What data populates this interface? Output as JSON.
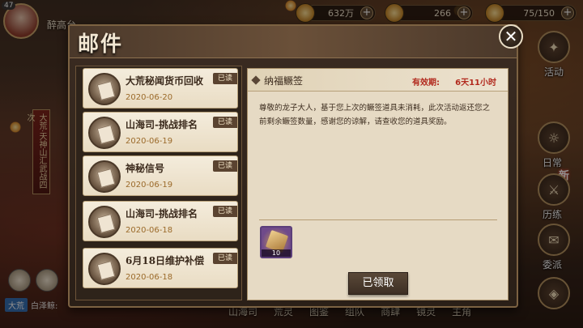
{
  "player": {
    "level": "47",
    "name": "醉高台"
  },
  "resources": [
    {
      "icon": "coin-icon",
      "value": "632万"
    },
    {
      "icon": "gold-ingot-icon",
      "value": "266"
    },
    {
      "icon": "stamina-icon",
      "value": "75/150"
    }
  ],
  "side_menu": {
    "activity": "活动",
    "daily": "日常",
    "trial": "历练",
    "dispatch": "委派",
    "new_tag": "新"
  },
  "left_banner": "大荒·天神山汇武战四次",
  "chat": {
    "channel": "大荒",
    "speaker": "白泽鲸:"
  },
  "bottom_nav": [
    "山海司",
    "荒灵",
    "图鉴",
    "组队",
    "商肆",
    "镜灵",
    "主角"
  ],
  "mail": {
    "title": "邮件",
    "read_label": "已读",
    "items": [
      {
        "title": "大荒秘闻货币回收",
        "date": "2020-06-20"
      },
      {
        "title": "山海司-挑战排名",
        "date": "2020-06-19"
      },
      {
        "title": "神秘信号",
        "date": "2020-06-19"
      },
      {
        "title": "山海司-挑战排名",
        "date": "2020-06-18"
      },
      {
        "title": "6月18日维护补偿",
        "date": "2020-06-18"
      }
    ],
    "detail": {
      "title": "纳福鳜签",
      "expire_label": "有效期:",
      "expire_value": "6天11小时",
      "body": "尊敬的龙子大人，基于您上次的鳜签道具未消耗，此次活动返还您之前剩余鳜签数量，感谢您的谅解，请查收您的道具奖励。",
      "reward_count": "10",
      "claim_label": "已领取"
    }
  }
}
